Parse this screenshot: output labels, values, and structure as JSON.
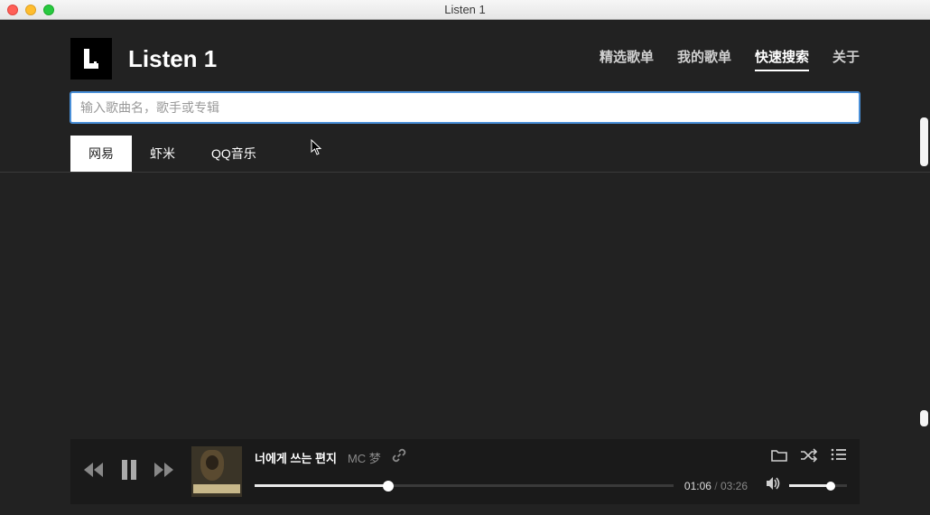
{
  "window": {
    "title": "Listen 1"
  },
  "brand": {
    "name": "Listen 1",
    "logo_letter": "L"
  },
  "nav": {
    "items": [
      {
        "label": "精选歌单",
        "active": false
      },
      {
        "label": "我的歌单",
        "active": false
      },
      {
        "label": "快速搜索",
        "active": true
      },
      {
        "label": "关于",
        "active": false
      }
    ]
  },
  "search": {
    "value": "",
    "placeholder": "输入歌曲名，歌手或专辑"
  },
  "sources": {
    "tabs": [
      {
        "label": "网易",
        "active": true
      },
      {
        "label": "虾米",
        "active": false
      },
      {
        "label": "QQ音乐",
        "active": false
      }
    ]
  },
  "player": {
    "track_title": "너에게 쓰는 편지",
    "track_artist": "MC 梦",
    "elapsed": "01:06",
    "duration": "03:26",
    "progress_pct": 32,
    "volume_pct": 72
  },
  "colors": {
    "bg": "#222222",
    "accent": "#4a90d9"
  }
}
